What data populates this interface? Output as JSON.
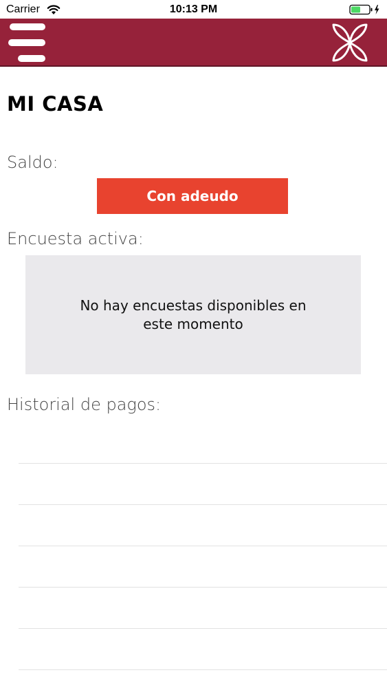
{
  "status_bar": {
    "carrier": "Carrier",
    "time": "10:13 PM",
    "wifi_icon": "wifi-icon",
    "battery_icon": "battery-charging-icon"
  },
  "header": {
    "background_color": "#96223a",
    "menu_icon": "hamburger-menu-icon",
    "logo_icon": "butterfly-logo-icon"
  },
  "page": {
    "title": "MI CASA"
  },
  "balance": {
    "label": "Saldo:",
    "status": "Con adeudo",
    "status_color": "#e8432f"
  },
  "survey": {
    "label": "Encuesta activa:",
    "message": "No hay encuestas disponibles en este momento"
  },
  "payments": {
    "label": "Historial de pagos:",
    "rows": [
      "",
      "",
      "",
      "",
      "",
      ""
    ]
  }
}
